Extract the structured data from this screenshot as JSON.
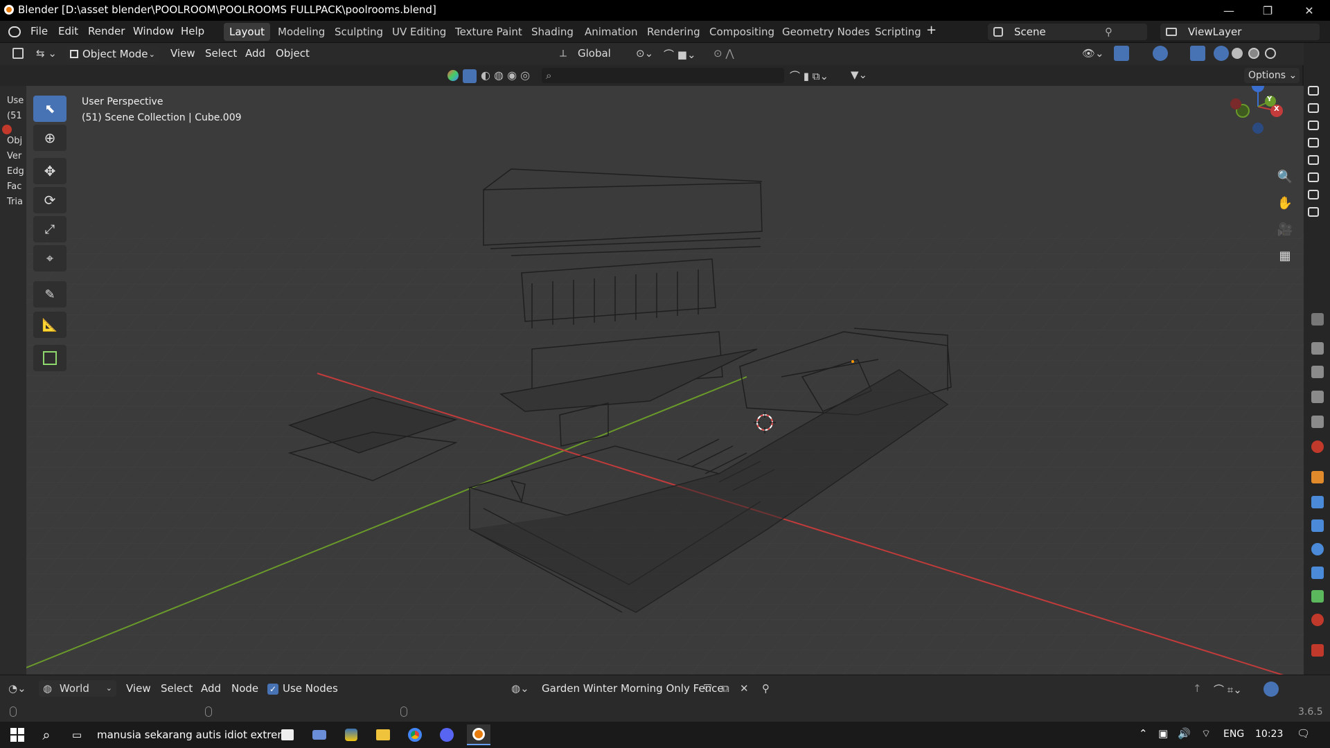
{
  "window": {
    "title": "Blender [D:\\asset blender\\POOLROOM\\POOLROOMS FULLPACK\\poolrooms.blend]"
  },
  "menus": [
    "File",
    "Edit",
    "Render",
    "Window",
    "Help"
  ],
  "workspaces": [
    "Layout",
    "Modeling",
    "Sculpting",
    "UV Editing",
    "Texture Paint",
    "Shading",
    "Animation",
    "Rendering",
    "Compositing",
    "Geometry Nodes",
    "Scripting"
  ],
  "active_workspace": "Layout",
  "scene": {
    "name": "Scene",
    "view_layer": "ViewLayer"
  },
  "viewport_header": {
    "mode": "Object Mode",
    "menus": [
      "View",
      "Select",
      "Add",
      "Object"
    ],
    "transform_orientation": "Global",
    "options_label": "Options"
  },
  "viewport": {
    "perspective": "User Perspective",
    "collection_info": "(51) Scene Collection | Cube.009",
    "gizmo_axes": [
      "Z",
      "Y",
      "X"
    ],
    "colors": {
      "x_axis": "#c33b3b",
      "y_axis": "#6a9a2a",
      "grid": "#454545",
      "background": "#3c3c3c"
    }
  },
  "left_panel_partial": [
    "Use",
    "(51",
    "Obj",
    "Ver",
    "Edg",
    "Fac",
    "Tria"
  ],
  "tools": [
    "select-box",
    "cursor",
    "move",
    "rotate",
    "scale",
    "transform",
    "annotate",
    "measure",
    "add-cube"
  ],
  "node_header": {
    "editor": "World",
    "menus": [
      "View",
      "Select",
      "Add",
      "Node"
    ],
    "use_nodes_label": "Use Nodes",
    "use_nodes_checked": true,
    "world_name": "Garden Winter Morning Only Fence"
  },
  "statusbar": {
    "version": "3.6.5"
  },
  "taskbar": {
    "window_text": "manusia sekarang autis idiot extreme",
    "language": "ENG",
    "time": "10:23"
  },
  "icons": {
    "accent": "#4772b3"
  }
}
